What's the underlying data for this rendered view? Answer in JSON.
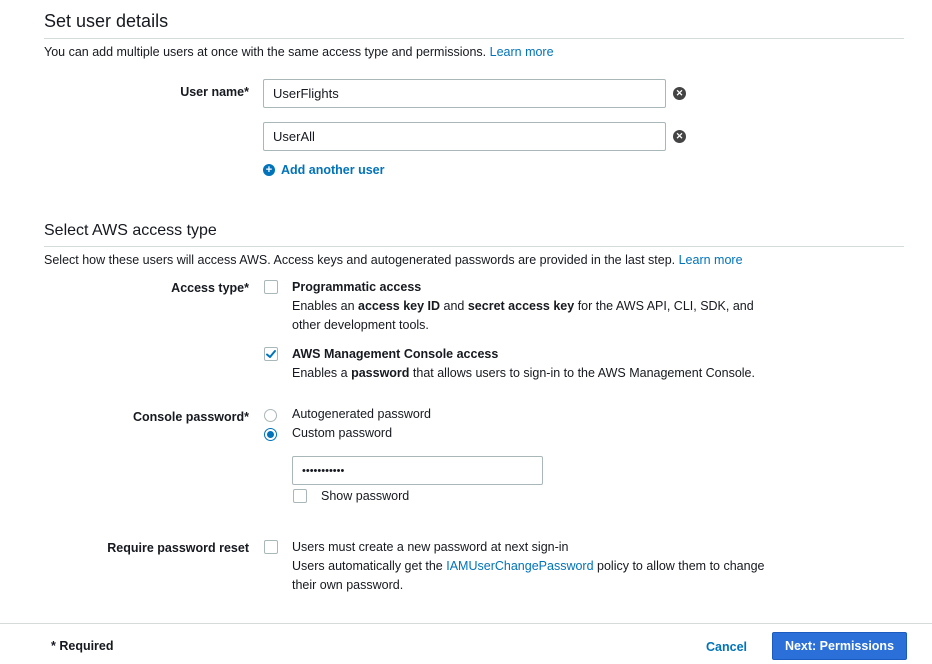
{
  "user_details": {
    "title": "Set user details",
    "description": "You can add multiple users at once with the same access type and permissions.",
    "learn_more": "Learn more",
    "user_name_label": "User name*",
    "users": [
      "UserFlights",
      "UserAll"
    ],
    "add_another_user": "Add another user"
  },
  "access_type": {
    "title": "Select AWS access type",
    "description": "Select how these users will access AWS. Access keys and autogenerated passwords are provided in the last step.",
    "learn_more": "Learn more",
    "label": "Access type*",
    "programmatic": {
      "title": "Programmatic access",
      "checked": false,
      "desc_1": "Enables an ",
      "desc_b1": "access key ID",
      "desc_2": " and ",
      "desc_b2": "secret access key",
      "desc_3": " for the AWS API, CLI, SDK, and",
      "desc_line2": "other development tools."
    },
    "console": {
      "title": "AWS Management Console access",
      "checked": true,
      "desc_1": "Enables a ",
      "desc_b1": "password",
      "desc_2": " that allows users to sign-in to the AWS Management Console."
    }
  },
  "console_password": {
    "label": "Console password*",
    "options": [
      "Autogenerated password",
      "Custom password"
    ],
    "selected": "Custom password",
    "value": "•••••••••••",
    "show_password": "Show password"
  },
  "password_reset": {
    "label": "Require password reset",
    "checked": false,
    "line1": "Users must create a new password at next sign-in",
    "line2_a": "Users automatically get the ",
    "policy_link": "IAMUserChangePassword",
    "line2_b": " policy to allow them to change",
    "line3": "their own password."
  },
  "footer": {
    "required_note": "* Required",
    "cancel": "Cancel",
    "next": "Next: Permissions"
  },
  "colors": {
    "link": "#0073bb",
    "primary_button": "#2b6fd9",
    "checkbox_check": "#0073bb"
  }
}
